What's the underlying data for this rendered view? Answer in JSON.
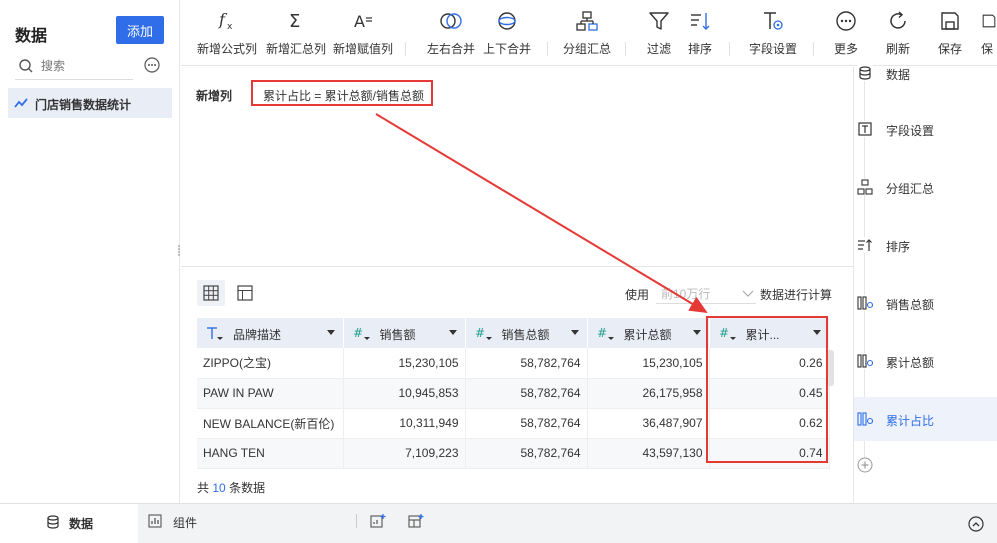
{
  "left_panel": {
    "title": "数据",
    "add_label": "添加",
    "search_placeholder": "搜索",
    "dataset_name": "门店销售数据统计"
  },
  "toolbar": {
    "items": [
      {
        "label": "新增公式列",
        "icon": "function-icon"
      },
      {
        "label": "新增汇总列",
        "icon": "sigma-icon"
      },
      {
        "label": "新增赋值列",
        "icon": "assign-icon"
      },
      {
        "label": "左右合并",
        "icon": "left-right-merge-icon"
      },
      {
        "label": "上下合并",
        "icon": "up-down-merge-icon"
      },
      {
        "label": "分组汇总",
        "icon": "group-summary-icon"
      },
      {
        "label": "过滤",
        "icon": "filter-icon"
      },
      {
        "label": "排序",
        "icon": "sort-icon"
      },
      {
        "label": "字段设置",
        "icon": "field-settings-icon"
      },
      {
        "label": "更多",
        "icon": "more-icon"
      },
      {
        "label": "刷新",
        "icon": "refresh-icon"
      },
      {
        "label": "保存",
        "icon": "save-icon"
      },
      {
        "label": "保",
        "icon": "save-icon"
      }
    ]
  },
  "formula": {
    "label": "新增列",
    "text": "累计占比 = 累计总额/销售总额"
  },
  "table_controls": {
    "use_label": "使用",
    "sample_value": "前10万行",
    "calc_label": "数据进行计算"
  },
  "table": {
    "columns": [
      {
        "label": "品牌描述",
        "type": "text"
      },
      {
        "label": "销售额",
        "type": "number"
      },
      {
        "label": "销售总额",
        "type": "number"
      },
      {
        "label": "累计总额",
        "type": "number"
      },
      {
        "label": "累计...",
        "type": "number"
      }
    ],
    "rows": [
      [
        "ZIPPO(之宝)",
        "15,230,105",
        "58,782,764",
        "15,230,105",
        "0.26"
      ],
      [
        "PAW IN PAW",
        "10,945,853",
        "58,782,764",
        "26,175,958",
        "0.45"
      ],
      [
        "NEW BALANCE(新百伦)",
        "10,311,949",
        "58,782,764",
        "36,487,907",
        "0.62"
      ],
      [
        "HANG TEN",
        "7,109,223",
        "58,782,764",
        "43,597,130",
        "0.74"
      ]
    ],
    "count_prefix": "共",
    "count": "10",
    "count_suffix": "条数据"
  },
  "steps": [
    {
      "label": "数据",
      "icon": "database-icon"
    },
    {
      "label": "字段设置",
      "icon": "field-settings-icon"
    },
    {
      "label": "分组汇总",
      "icon": "group-summary-icon"
    },
    {
      "label": "排序",
      "icon": "sort-icon"
    },
    {
      "label": "销售总额",
      "icon": "summary-column-icon"
    },
    {
      "label": "累计总额",
      "icon": "summary-column-icon"
    },
    {
      "label": "累计占比",
      "icon": "formula-column-icon",
      "active": true
    }
  ],
  "bottom_bar": {
    "tab_data": "数据",
    "tab_component": "组件"
  },
  "colors": {
    "accent": "#2f6ee8",
    "annotation": "#e53935",
    "header_bg": "#e9edf5"
  }
}
